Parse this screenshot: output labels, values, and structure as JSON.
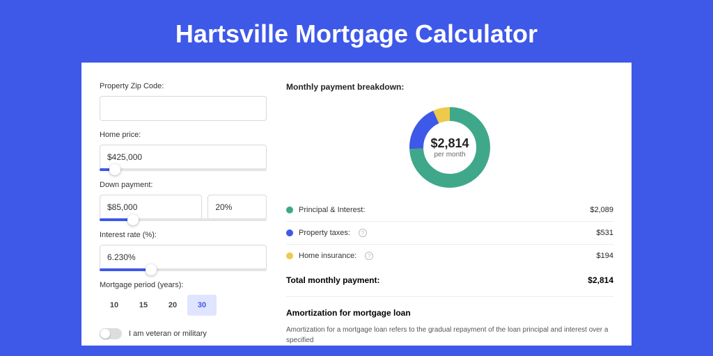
{
  "title": "Hartsville Mortgage Calculator",
  "form": {
    "zip": {
      "label": "Property Zip Code:",
      "value": ""
    },
    "price": {
      "label": "Home price:",
      "value": "$425,000",
      "slider_pct": 9
    },
    "down": {
      "label": "Down payment:",
      "amount": "$85,000",
      "pct": "20%",
      "slider_pct": 20
    },
    "rate": {
      "label": "Interest rate (%):",
      "value": "6.230%",
      "slider_pct": 31
    },
    "period": {
      "label": "Mortgage period (years):",
      "options": [
        "10",
        "15",
        "20",
        "30"
      ],
      "selected": "30"
    },
    "veteran": {
      "label": "I am veteran or military",
      "on": false
    }
  },
  "breakdown": {
    "title": "Monthly payment breakdown:",
    "center_value": "$2,814",
    "center_sub": "per month",
    "items": [
      {
        "label": "Principal & Interest:",
        "value": "$2,089",
        "color": "#3fa88a",
        "info": false
      },
      {
        "label": "Property taxes:",
        "value": "$531",
        "color": "#3e58e8",
        "info": true
      },
      {
        "label": "Home insurance:",
        "value": "$194",
        "color": "#efc94c",
        "info": true
      }
    ],
    "total_label": "Total monthly payment:",
    "total_value": "$2,814"
  },
  "chart_data": {
    "type": "pie",
    "title": "Monthly payment breakdown",
    "series": [
      {
        "name": "Principal & Interest",
        "value": 2089,
        "color": "#3fa88a"
      },
      {
        "name": "Property taxes",
        "value": 531,
        "color": "#3e58e8"
      },
      {
        "name": "Home insurance",
        "value": 194,
        "color": "#efc94c"
      }
    ],
    "total": 2814,
    "unit": "USD/month"
  },
  "amort": {
    "title": "Amortization for mortgage loan",
    "text": "Amortization for a mortgage loan refers to the gradual repayment of the loan principal and interest over a specified"
  }
}
